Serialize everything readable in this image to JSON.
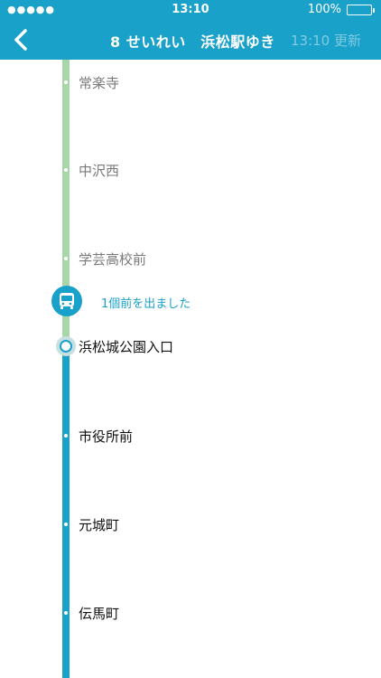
{
  "status_bar": {
    "signal": "●●●●●",
    "time": "13:10",
    "battery": "100%"
  },
  "nav": {
    "title": "8 せいれい　浜松駅ゆき",
    "updated": "13:10 更新"
  },
  "bus": {
    "status": "1個前を出ました"
  },
  "stops": [
    {
      "name": "常楽寺",
      "state": "passed"
    },
    {
      "name": "中沢西",
      "state": "passed"
    },
    {
      "name": "学芸高校前",
      "state": "passed"
    },
    {
      "name": "浜松城公園入口",
      "state": "current"
    },
    {
      "name": "市役所前",
      "state": "upcoming"
    },
    {
      "name": "元城町",
      "state": "upcoming"
    },
    {
      "name": "伝馬町",
      "state": "upcoming"
    }
  ],
  "colors": {
    "accent": "#1aa1c9",
    "passed_line": "#a9d6a8",
    "battery": "#4cd964"
  },
  "icons": {
    "back": "chevron-left-icon",
    "bus": "bus-icon",
    "battery": "battery-icon"
  }
}
